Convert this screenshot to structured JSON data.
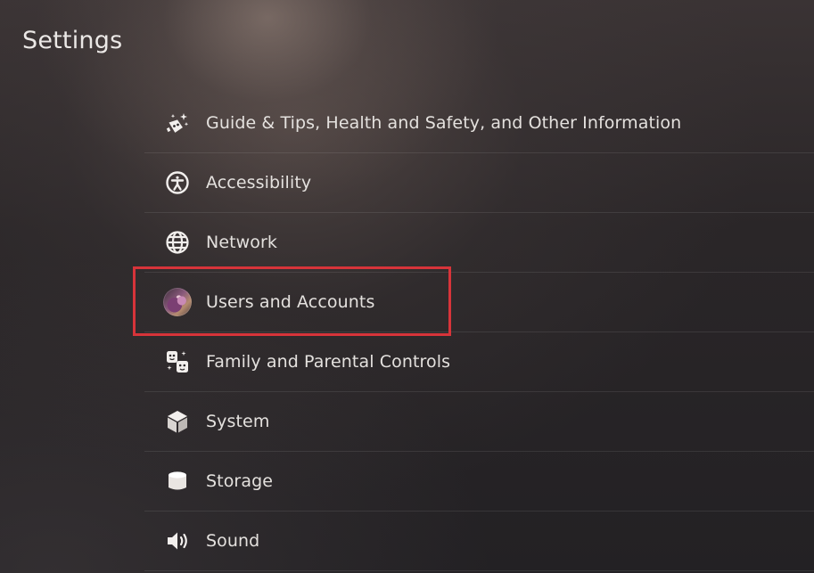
{
  "header": {
    "title": "Settings"
  },
  "settings": {
    "items": [
      {
        "label": "Guide & Tips, Health and Safety, and Other Information",
        "icon": "sparkle-dice-icon"
      },
      {
        "label": "Accessibility",
        "icon": "accessibility-icon"
      },
      {
        "label": "Network",
        "icon": "globe-icon"
      },
      {
        "label": "Users and Accounts",
        "icon": "user-avatar"
      },
      {
        "label": "Family and Parental Controls",
        "icon": "family-faces-icon"
      },
      {
        "label": "System",
        "icon": "cube-icon"
      },
      {
        "label": "Storage",
        "icon": "cylinder-icon"
      },
      {
        "label": "Sound",
        "icon": "speaker-icon"
      }
    ],
    "highlighted_item": "Users and Accounts"
  },
  "colors": {
    "highlight_border": "#d7343a",
    "text": "#e4e1de",
    "icon": "#f2efed"
  }
}
